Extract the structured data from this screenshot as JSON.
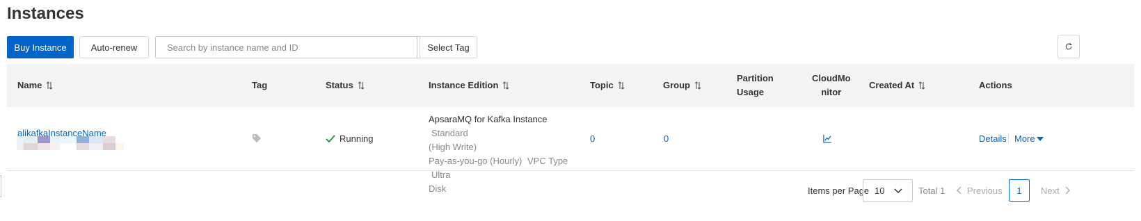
{
  "page": {
    "title": "Instances"
  },
  "toolbar": {
    "buy_label": "Buy Instance",
    "autorenew_label": "Auto-renew",
    "search_placeholder": "Search by instance name and ID",
    "select_tag_label": "Select Tag"
  },
  "table": {
    "columns": {
      "name": "Name",
      "tag": "Tag",
      "status": "Status",
      "edition": "Instance Edition",
      "topic": "Topic",
      "group": "Group",
      "partition_line1": "Partition",
      "partition_line2": "Usage",
      "cloudmonitor_line1": "CloudMo",
      "cloudmonitor_line2": "nitor",
      "created": "Created At",
      "actions": "Actions"
    },
    "rows": [
      {
        "name": "alikafkaInstanceName",
        "status": "Running",
        "edition_product": "ApsaraMQ for Kafka Instance",
        "edition_spec_line1": "Standard",
        "edition_spec_line2": "(High Write)",
        "billing": "Pay-as-you-go (Hourly)",
        "network": "VPC Type",
        "disk_line1": "Ultra",
        "disk_line2": "Disk",
        "topic": "0",
        "group": "0",
        "action_details": "Details",
        "action_more": "More"
      }
    ]
  },
  "pagination": {
    "items_per_page_label": "Items per Page",
    "page_size": "10",
    "total": "Total 1",
    "previous": "Previous",
    "current_page": "1",
    "next": "Next"
  },
  "icons": {
    "search": "search-icon",
    "refresh": "refresh-icon",
    "sort": "sort-icon",
    "tag": "tag-icon",
    "status_ok": "check-icon",
    "monitor": "line-chart-icon",
    "dropdown": "caret-down-icon"
  },
  "colors": {
    "primary": "#0064c8",
    "running": "#1e8e3e",
    "header_bg": "#f2f4f6"
  }
}
